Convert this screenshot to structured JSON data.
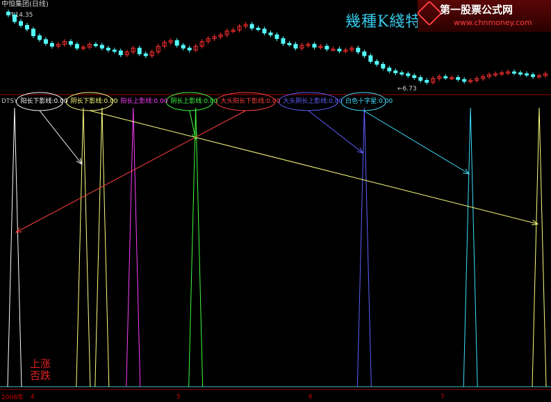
{
  "window": {
    "title": "中恒集团(日线)"
  },
  "price": {
    "high_label": "14.35",
    "low_label": "6.73",
    "arrow_glyph": "←"
  },
  "overlay_title": "幾種K綫特殊形態",
  "watermark": {
    "main": "第一股票公式网",
    "url": "www.chnmoney.com"
  },
  "indicator": {
    "name": "DTSY",
    "items": [
      {
        "label": "阳长下影线",
        "value": "0.00",
        "color": "#ffffff"
      },
      {
        "label": "阴长下影线",
        "value": "0.00",
        "color": "#ffff80"
      },
      {
        "label": "阳长上影线",
        "value": "0.00",
        "color": "#ff40ff"
      },
      {
        "label": "阴长上影线",
        "value": "0.00",
        "color": "#40ff40"
      },
      {
        "label": "大头阳长下影线",
        "value": "0.00",
        "color": "#ff4040"
      },
      {
        "label": "大头阴长上影线",
        "value": "0.00",
        "color": "#6060ff"
      },
      {
        "label": "白色十字星",
        "value": "0.00",
        "color": "#40e0ff"
      }
    ]
  },
  "stamp": {
    "line1": "上涨",
    "line2": "否跌"
  },
  "axis": {
    "year_label": "2008年",
    "months": [
      "4",
      "5",
      "6",
      "7"
    ]
  },
  "colors": {
    "up": "#ff3030",
    "down": "#54ffff",
    "grid_red": "#a00000",
    "base": "#40c0c0"
  },
  "chart_data": {
    "type": "candlestick_with_signals",
    "price_range": [
      6.73,
      14.35
    ],
    "candles_close": [
      14.1,
      13.4,
      13.0,
      12.6,
      11.9,
      11.5,
      11.1,
      10.8,
      11.0,
      11.3,
      11.0,
      10.6,
      10.7,
      11.0,
      10.9,
      10.6,
      10.4,
      10.3,
      9.9,
      10.2,
      10.6,
      10.0,
      9.8,
      10.2,
      10.8,
      11.2,
      11.4,
      10.9,
      10.6,
      10.4,
      10.8,
      11.3,
      11.6,
      11.8,
      12.0,
      12.4,
      12.5,
      12.9,
      13.1,
      12.7,
      12.6,
      12.2,
      12.0,
      11.6,
      11.1,
      11.0,
      10.6,
      10.9,
      11.0,
      10.7,
      10.8,
      10.5,
      10.5,
      10.3,
      10.4,
      10.6,
      10.2,
      9.8,
      9.2,
      8.9,
      8.5,
      8.2,
      8.0,
      7.9,
      7.7,
      7.5,
      7.2,
      7.0,
      7.4,
      7.6,
      7.5,
      7.5,
      7.3,
      7.1,
      7.2,
      7.4,
      7.6,
      7.8,
      7.9,
      8.0,
      8.1,
      8.0,
      7.9,
      7.8,
      7.6,
      7.7,
      7.9
    ],
    "signals": [
      {
        "series": "阳长下影线",
        "candle_index": 1
      },
      {
        "series": "阴长下影线",
        "candle_index": 12
      },
      {
        "series": "阴长下影线",
        "candle_index": 15
      },
      {
        "series": "阳长上影线",
        "candle_index": 20
      },
      {
        "series": "阴长上影线",
        "candle_index": 30
      },
      {
        "series": "大头阴长上影线",
        "candle_index": 57
      },
      {
        "series": "白色十字星",
        "candle_index": 74
      },
      {
        "series": "阴长下影线",
        "candle_index": 85
      }
    ]
  }
}
